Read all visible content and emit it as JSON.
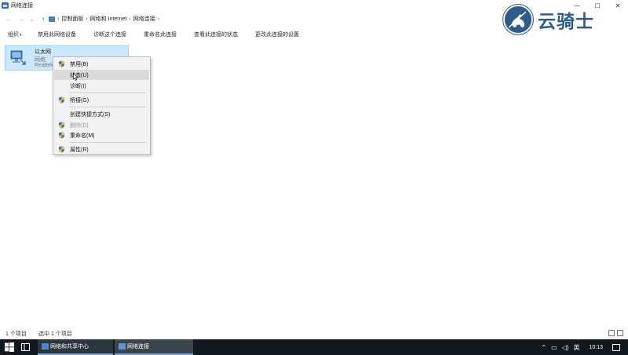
{
  "window": {
    "title": "网络连接",
    "controls": {
      "minimize": "—",
      "maximize": "☐",
      "close": "✕"
    }
  },
  "nav": {
    "back": "←",
    "forward": "→",
    "recent": "⌄",
    "up": "↑"
  },
  "breadcrumb": {
    "items": [
      "控制面板",
      "网络和 Internet",
      "网络连接"
    ],
    "separator": "›"
  },
  "toolbar": {
    "organize": "组织",
    "disable_device": "禁用此网络设备",
    "diagnose": "诊断这个连接",
    "rename": "重命名此连接",
    "view_status": "查看此连接的状态",
    "change_settings": "更改此连接的设置"
  },
  "adapter": {
    "name": "以太网",
    "status": "网络",
    "device": "Realtek"
  },
  "context_menu": {
    "items": [
      {
        "label": "禁用(B)",
        "icon": "shield-icon",
        "disabled": false
      },
      {
        "label": "状态(U)",
        "icon": "",
        "disabled": false,
        "highlighted": true
      },
      {
        "label": "诊断(I)",
        "icon": "",
        "disabled": false
      },
      {
        "label": "桥接(G)",
        "icon": "shield-icon",
        "disabled": false
      },
      {
        "label": "创建快捷方式(S)",
        "icon": "",
        "disabled": false
      },
      {
        "label": "删除(D)",
        "icon": "shield-icon",
        "disabled": true
      },
      {
        "label": "重命名(M)",
        "icon": "shield-icon",
        "disabled": false
      },
      {
        "label": "属性(R)",
        "icon": "shield-icon",
        "disabled": false
      }
    ]
  },
  "watermark": {
    "text": "云骑士"
  },
  "status": {
    "count": "1 个项目",
    "selected": "选中 1 个项目"
  },
  "taskbar": {
    "items": [
      {
        "label": "网络和共享中心"
      },
      {
        "label": "网络连接"
      }
    ],
    "ime": "英",
    "clock": "10:13"
  },
  "colors": {
    "selection": "#cce8ff",
    "menu_bg": "#f2f2f2",
    "menu_hover": "#dadada",
    "taskbar": "#101820",
    "watermark": "#2e5d8a"
  }
}
